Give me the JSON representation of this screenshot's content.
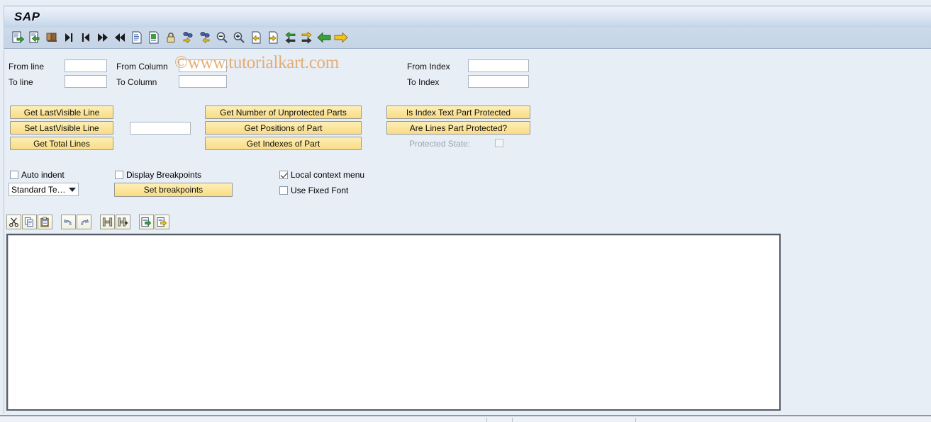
{
  "window": {
    "title": "SAP",
    "watermark": "©www.tutorialkart.com"
  },
  "toolbar": {
    "icons": [
      {
        "name": "open-document-icon",
        "label": "Open"
      },
      {
        "name": "import-document-icon",
        "label": "Import"
      },
      {
        "name": "exit-door-icon",
        "label": "Exit"
      },
      {
        "name": "goto-last-icon",
        "label": "Go To Last"
      },
      {
        "name": "goto-first-icon",
        "label": "Go To First"
      },
      {
        "name": "forward-fast-icon",
        "label": "Forward"
      },
      {
        "name": "backward-fast-icon",
        "label": "Backward"
      },
      {
        "name": "document-list-icon",
        "label": "Display List"
      },
      {
        "name": "document-green-icon",
        "label": "Display Document"
      },
      {
        "name": "lock-icon",
        "label": "Protect"
      },
      {
        "name": "attributes-add-icon",
        "label": "Set Attributes"
      },
      {
        "name": "attributes-remove-icon",
        "label": "Get Attributes"
      },
      {
        "name": "zoom-out-icon",
        "label": "Zoom Out"
      },
      {
        "name": "zoom-in-icon",
        "label": "Zoom In"
      },
      {
        "name": "document-in-icon",
        "label": "Insert Into"
      },
      {
        "name": "document-out-icon",
        "label": "Extract From"
      },
      {
        "name": "exchange-left-icon",
        "label": "Exchange Left"
      },
      {
        "name": "exchange-right-icon",
        "label": "Exchange Right"
      },
      {
        "name": "arrow-left-green-icon",
        "label": "Previous"
      },
      {
        "name": "arrow-right-yellow-icon",
        "label": "Next"
      }
    ]
  },
  "form": {
    "fields": [
      {
        "name": "from-line",
        "label": "From line",
        "value": ""
      },
      {
        "name": "from-column",
        "label": "From Column",
        "value": ""
      },
      {
        "name": "from-index",
        "label": "From Index",
        "value": ""
      },
      {
        "name": "to-line",
        "label": "To line",
        "value": ""
      },
      {
        "name": "to-column",
        "label": "To Column",
        "value": ""
      },
      {
        "name": "to-index",
        "label": "To Index",
        "value": ""
      }
    ]
  },
  "actions": {
    "col1": [
      {
        "name": "get-lastvisible-line",
        "label": "Get LastVisible Line"
      },
      {
        "name": "set-lastvisible-line",
        "label": "Set LastVisible Line"
      },
      {
        "name": "get-total-lines",
        "label": "Get Total Lines"
      }
    ],
    "value_input": "",
    "col2": [
      {
        "name": "get-number-of-unprotected-parts",
        "label": "Get Number of Unprotected Parts"
      },
      {
        "name": "get-positions-of-part",
        "label": "Get Positions of Part"
      },
      {
        "name": "get-indexes-of-part",
        "label": "Get Indexes of Part"
      }
    ],
    "col3": [
      {
        "name": "is-index-text-part-protected",
        "label": "Is Index Text Part Protected"
      },
      {
        "name": "are-lines-part-protected",
        "label": "Are Lines Part Protected?"
      }
    ],
    "protected_state_label": "Protected State:",
    "protected_state_checked": false
  },
  "options": {
    "auto_indent": {
      "label": "Auto indent",
      "checked": false
    },
    "display_breakpoints": {
      "label": "Display Breakpoints",
      "checked": false
    },
    "local_context_menu": {
      "label": "Local context menu",
      "checked": true
    },
    "use_fixed_font": {
      "label": "Use Fixed Font",
      "checked": false
    },
    "text_mode": {
      "label": "Standard Te…"
    },
    "set_breakpoints_label": "Set breakpoints"
  },
  "editor_toolbar": {
    "icons": [
      {
        "name": "cut-icon",
        "label": "Cut"
      },
      {
        "name": "copy-icon",
        "label": "Copy"
      },
      {
        "name": "paste-icon",
        "label": "Paste"
      },
      {
        "name": "undo-icon",
        "label": "Undo"
      },
      {
        "name": "redo-icon",
        "label": "Redo"
      },
      {
        "name": "find-icon",
        "label": "Find"
      },
      {
        "name": "find-next-icon",
        "label": "Find Next"
      },
      {
        "name": "import-text-icon",
        "label": "Upload"
      },
      {
        "name": "export-text-icon",
        "label": "Download"
      }
    ]
  },
  "editor": {
    "content": ""
  },
  "colors": {
    "background": "#e8eef6",
    "button": "#fbe59b",
    "titlebar": "#c3d5ea",
    "watermark": "#e3a86b"
  }
}
